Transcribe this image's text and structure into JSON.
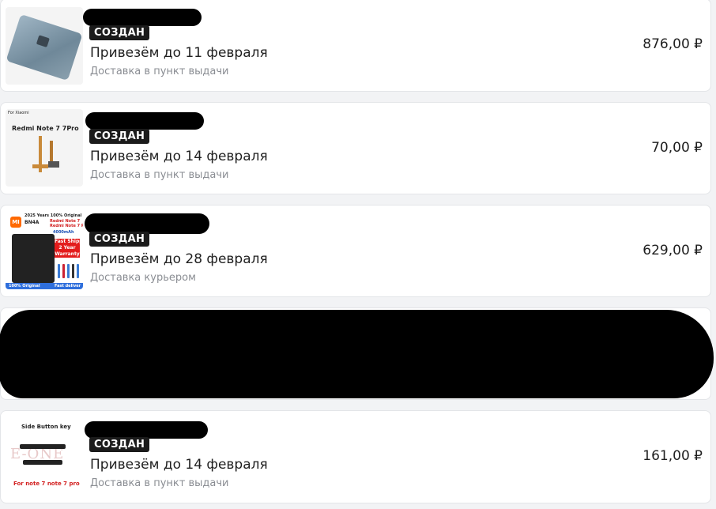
{
  "orders": [
    {
      "status": "СОЗДАН",
      "delivery_title": "Привезём до 11 февраля",
      "delivery_type": "Доставка в пункт выдачи",
      "price": "876,00 ₽",
      "thumb_icon": "back-glass-icon"
    },
    {
      "status": "СОЗДАН",
      "delivery_title": "Привезём до 14 февраля",
      "delivery_type": "Доставка в пункт выдачи",
      "price": "70,00 ₽",
      "thumb_icon": "flex-cable-icon",
      "thumb_text": {
        "brand": "For Xiaomi",
        "model": "Redmi Note 7 7Pro"
      }
    },
    {
      "status": "СОЗДАН",
      "delivery_title": "Привезём до 28 февраля",
      "delivery_type": "Доставка курьером",
      "price": "629,00 ₽",
      "thumb_icon": "battery-icon",
      "thumb_text": {
        "top": "2025 Years 100% Original",
        "code": "BN4A",
        "model": "Redmi Note 7\nRedmi Note 7 Pro",
        "capacity": "4000mAh",
        "warranty": "Fast Shipping\n2 Year\nWarranty",
        "bottom_left": "100% Original",
        "bottom_right": "Fast deliver"
      }
    },
    {
      "redacted": true
    },
    {
      "status": "СОЗДАН",
      "delivery_title": "Привезём до 14 февраля",
      "delivery_type": "Доставка в пункт выдачи",
      "price": "161,00 ₽",
      "thumb_icon": "side-button-key-icon",
      "thumb_text": {
        "title": "Side Button key",
        "watermark": "E-ONE",
        "caption": "For note 7 note 7 pro"
      }
    }
  ]
}
